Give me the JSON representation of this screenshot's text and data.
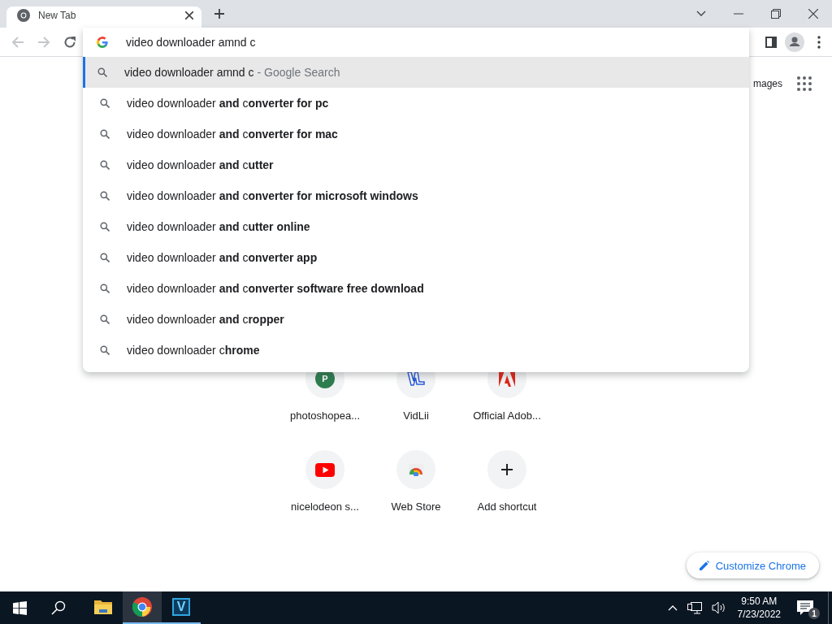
{
  "tabs": [
    {
      "title": "New Tab",
      "selected": true
    }
  ],
  "omnibox": {
    "value": "video downloader amnd c"
  },
  "suggestions": [
    {
      "text": "video downloader amnd c",
      "suffix": "- Google Search",
      "selected": true
    },
    {
      "text": "video downloader **and** c**onverter for pc**",
      "selected": false
    },
    {
      "text": "video downloader **and** c**onverter for mac**",
      "selected": false
    },
    {
      "text": "video downloader **and** c**utter**",
      "selected": false
    },
    {
      "text": "video downloader **and** c**onverter for microsoft windows**",
      "selected": false
    },
    {
      "text": "video downloader **and** c**utter online**",
      "selected": false
    },
    {
      "text": "video downloader **and** c**onverter app**",
      "selected": false
    },
    {
      "text": "video downloader **and** c**onverter software free download**",
      "selected": false
    },
    {
      "text": "video downloader **and** c**ropper**",
      "selected": false
    },
    {
      "text": "video downloader c**hrome**",
      "selected": false
    }
  ],
  "header_link": "mages",
  "shortcuts": [
    {
      "kind": "letter",
      "letter": "P",
      "label": "photoshopea..."
    },
    {
      "kind": "blue-logo",
      "label": "VidLii"
    },
    {
      "kind": "red-logo",
      "label": "Official Adob..."
    },
    {
      "kind": "video",
      "label": "nicelodeon s..."
    },
    {
      "kind": "store",
      "label": "Web Store"
    },
    {
      "kind": "add",
      "label": "Add shortcut"
    }
  ],
  "customize_button": "Customize Chrome",
  "taskbar": {
    "apps": [
      {
        "kind": "explorer",
        "selected": false
      },
      {
        "kind": "chrome",
        "selected": true
      },
      {
        "kind": "v-app",
        "letter": "V",
        "selected": false
      }
    ],
    "time": "9:50 AM",
    "date": "7/23/2022",
    "notification_count": "1"
  }
}
